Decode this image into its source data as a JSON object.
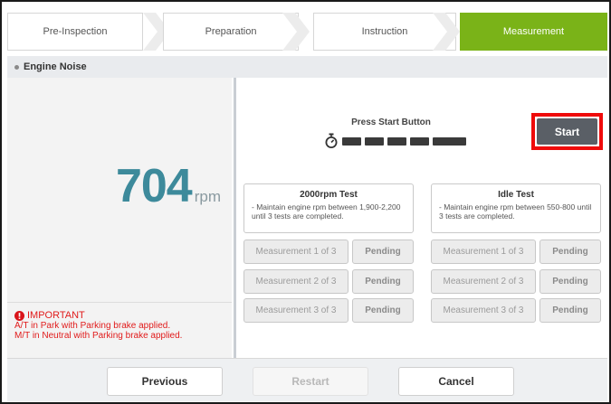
{
  "steps": [
    {
      "label": "Pre-Inspection",
      "active": false
    },
    {
      "label": "Preparation",
      "active": false
    },
    {
      "label": "Instruction",
      "active": false
    },
    {
      "label": "Measurement",
      "active": true
    }
  ],
  "section": {
    "title": "Engine Noise"
  },
  "gauge": {
    "value": "704",
    "unit": "rpm"
  },
  "important": {
    "title": "IMPORTANT",
    "lines": [
      "A/T in Park with Parking brake applied.",
      "M/T in Neutral with Parking brake applied."
    ]
  },
  "start_panel": {
    "prompt": "Press Start Button",
    "segments": 6,
    "start_label": "Start"
  },
  "tests": [
    {
      "title": "2000rpm Test",
      "description": "- Maintain engine rpm between 1,900-2,200 until 3 tests are completed.",
      "rows": [
        {
          "label": "Measurement 1 of 3",
          "status": "Pending"
        },
        {
          "label": "Measurement 2 of 3",
          "status": "Pending"
        },
        {
          "label": "Measurement 3 of 3",
          "status": "Pending"
        }
      ]
    },
    {
      "title": "Idle Test",
      "description": "- Maintain engine rpm between 550-800 until 3 tests are completed.",
      "rows": [
        {
          "label": "Measurement 1 of 3",
          "status": "Pending"
        },
        {
          "label": "Measurement 2 of 3",
          "status": "Pending"
        },
        {
          "label": "Measurement 3 of 3",
          "status": "Pending"
        }
      ]
    }
  ],
  "footer": {
    "previous_label": "Previous",
    "restart_label": "Restart",
    "cancel_label": "Cancel"
  },
  "colors": {
    "accent_green": "#7ab318",
    "rpm_teal": "#3d8a9b",
    "highlight_red": "#ef0a0a",
    "warning_red": "#e11b1b"
  }
}
